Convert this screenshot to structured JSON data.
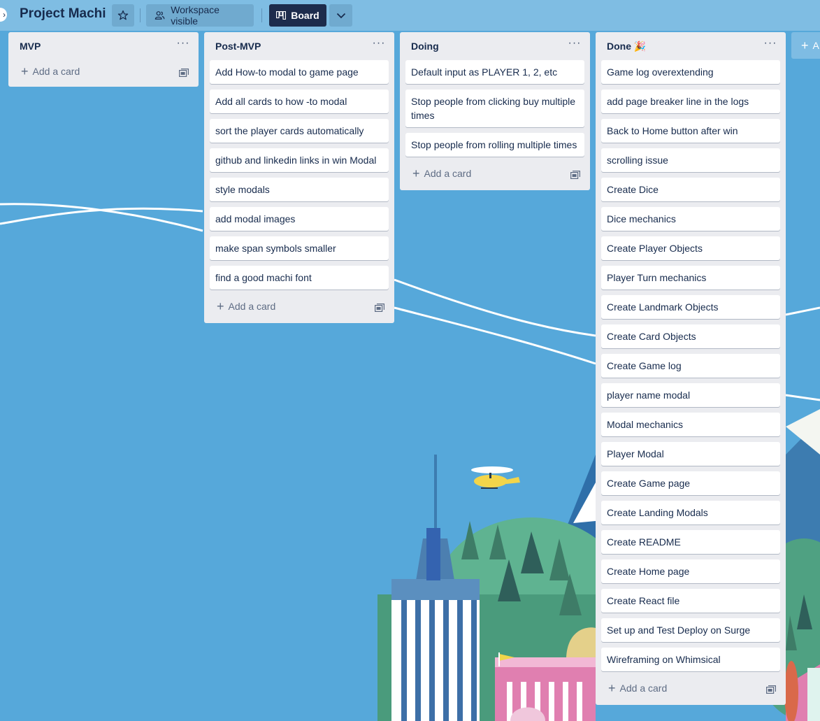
{
  "header": {
    "board_title": "Project Machi",
    "workspace_label": "Workspace visible",
    "view_label": "Board"
  },
  "lists": [
    {
      "title": "MVP",
      "cards": [],
      "add_card_label": "Add a card"
    },
    {
      "title": "Post-MVP",
      "cards": [
        "Add How-to modal to game page",
        "Add all cards to how -to modal",
        "sort the player cards automatically",
        "github and linkedin links in win Modal",
        "style modals",
        "add modal images",
        "make span symbols smaller",
        "find a good machi font"
      ],
      "add_card_label": "Add a card"
    },
    {
      "title": "Doing",
      "cards": [
        "Default input as PLAYER 1, 2, etc",
        "Stop people from clicking buy multiple times",
        "Stop people from rolling multiple times"
      ],
      "add_card_label": "Add a card"
    },
    {
      "title": "Done",
      "title_emoji": "🎉",
      "cards": [
        "Game log overextending",
        "add page breaker line in the logs",
        "Back to Home button after win",
        "scrolling issue",
        "Create Dice",
        "Dice mechanics",
        "Create Player Objects",
        "Player Turn mechanics",
        "Create Landmark Objects",
        "Create Card Objects",
        "Create Game log",
        "player name modal",
        "Modal mechanics",
        "Player Modal",
        "Create Game page",
        "Create Landing Modals",
        "Create README",
        "Create Home page",
        "Create React file",
        "Set up and Test Deploy on Surge",
        "Wireframing on Whimsical"
      ],
      "add_card_label": "Add a card"
    }
  ],
  "add_list_label": "A",
  "colors": {
    "background": "#56a8da",
    "list_bg": "#ebecf0",
    "card_bg": "#ffffff",
    "board_button": "#1d2c4c",
    "text": "#172b4d"
  }
}
